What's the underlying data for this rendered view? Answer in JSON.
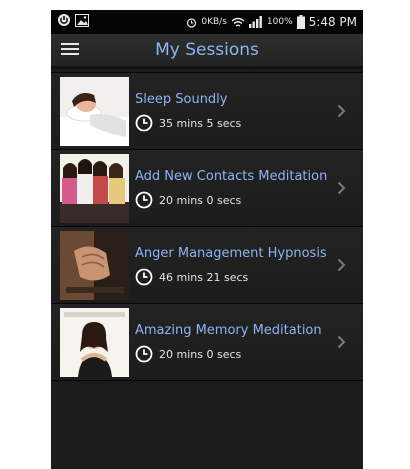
{
  "status_bar": {
    "data_rate": "0KB/s",
    "battery": "100%",
    "time": "5:48 PM"
  },
  "header": {
    "title": "My Sessions"
  },
  "sessions": [
    {
      "title": "Sleep Soundly",
      "duration": "35 mins 5 secs"
    },
    {
      "title": "Add New Contacts Meditation",
      "duration": "20 mins 0 secs"
    },
    {
      "title": "Anger Management Hypnosis",
      "duration": "46 mins 21 secs"
    },
    {
      "title": "Amazing Memory Meditation",
      "duration": "20 mins 0 secs"
    }
  ],
  "colors": {
    "accent_title": "#8db4f2",
    "background": "#1b1b1b"
  }
}
